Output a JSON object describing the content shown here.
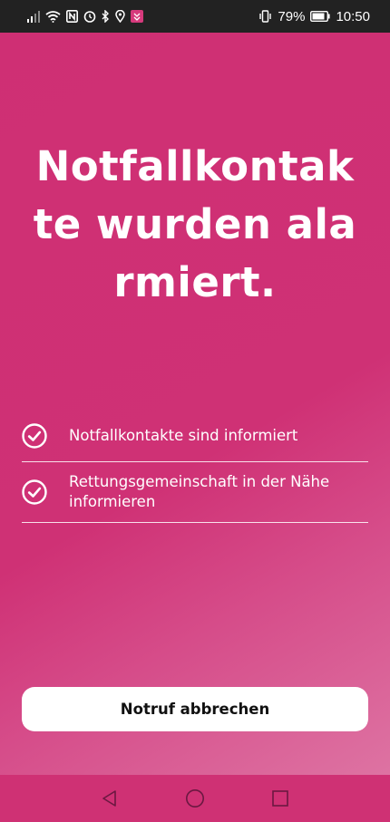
{
  "status_bar": {
    "battery_percent": "79%",
    "time": "10:50",
    "icons": [
      "signal-icon",
      "wifi-icon",
      "nfc-icon",
      "alarm-icon",
      "bluetooth-icon",
      "location-icon",
      "app-notification-icon",
      "vibrate-icon",
      "battery-icon"
    ]
  },
  "main": {
    "headline": "Notfallkontakte wurden alarmiert.",
    "checklist": [
      {
        "label": "Notfallkontakte sind informiert",
        "icon": "check-circle-icon"
      },
      {
        "label": "Rettungsgemeinschaft in der Nähe informieren",
        "icon": "check-circle-icon"
      }
    ],
    "cancel_button_label": "Notruf abbrechen"
  },
  "nav_bar": {
    "buttons": [
      "back-icon",
      "home-icon",
      "recents-icon"
    ]
  },
  "colors": {
    "background": "#cf3175",
    "status_bar": "#222222",
    "button_bg": "#ffffff",
    "text": "#ffffff"
  }
}
